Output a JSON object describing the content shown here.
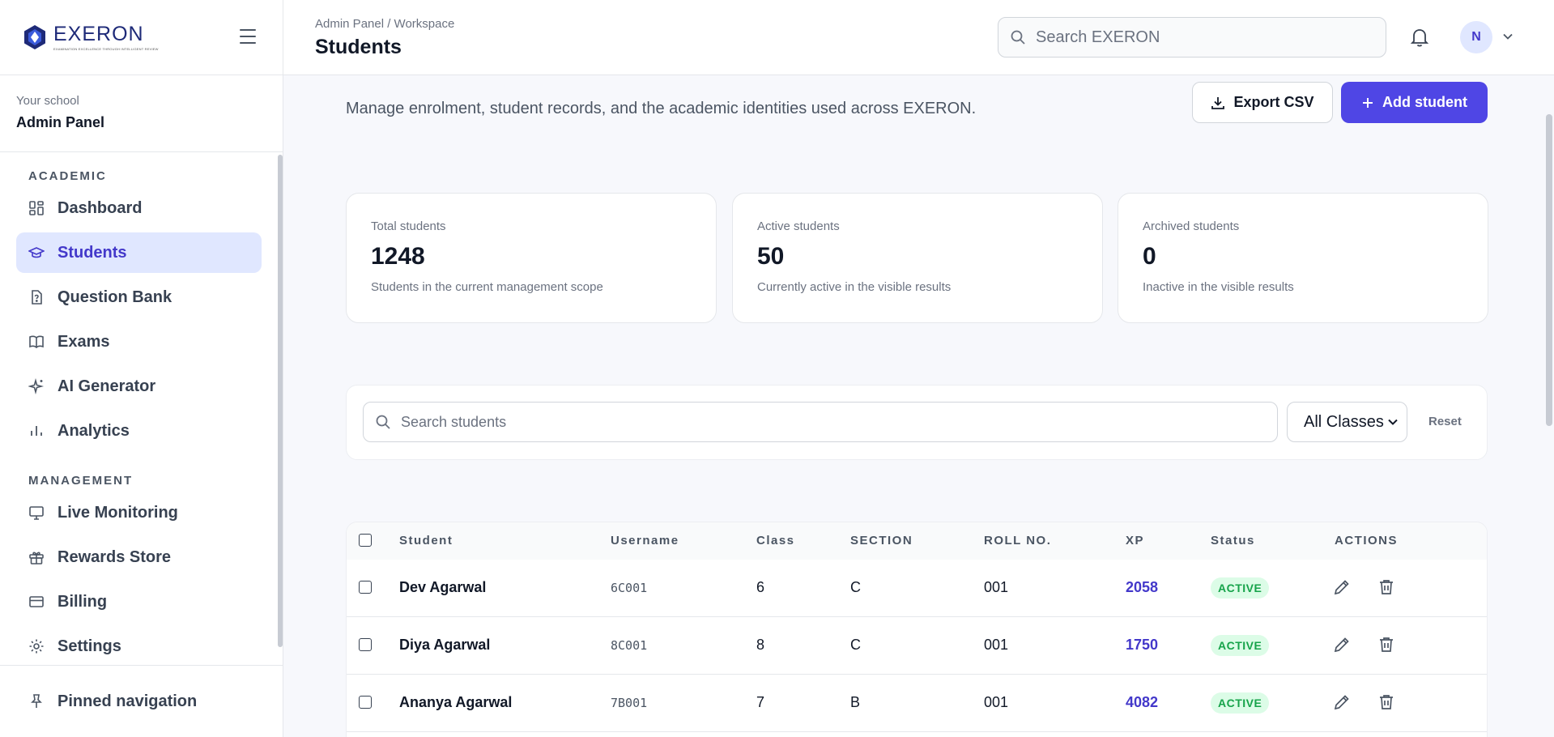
{
  "brand": {
    "name": "EXERON",
    "tagline": "EXAMINATION EXCELLENCE THROUGH INTELLIGENT REVIEW"
  },
  "school": {
    "label": "Your school",
    "name": "Admin Panel"
  },
  "nav": {
    "section_academic": "ACADEMIC",
    "section_management": "MANAGEMENT",
    "academic_items": [
      {
        "label": "Dashboard",
        "icon": "dashboard-grid-icon"
      },
      {
        "label": "Students",
        "icon": "graduation-cap-icon",
        "active": true
      },
      {
        "label": "Question Bank",
        "icon": "question-file-icon"
      },
      {
        "label": "Exams",
        "icon": "book-icon"
      },
      {
        "label": "AI Generator",
        "icon": "sparkles-icon"
      },
      {
        "label": "Analytics",
        "icon": "bar-chart-icon"
      }
    ],
    "management_items": [
      {
        "label": "Live Monitoring",
        "icon": "monitor-icon"
      },
      {
        "label": "Rewards Store",
        "icon": "gift-icon"
      },
      {
        "label": "Billing",
        "icon": "credit-card-icon"
      },
      {
        "label": "Settings",
        "icon": "gear-icon"
      }
    ],
    "pinned": "Pinned navigation"
  },
  "header": {
    "breadcrumb": "Admin Panel / Workspace",
    "title": "Students",
    "search_placeholder": "Search EXERON",
    "avatar_initial": "N"
  },
  "main": {
    "description": "Manage enrolment, student records, and the academic identities used across EXERON.",
    "export_label": "Export CSV",
    "add_label": "Add student"
  },
  "stats": [
    {
      "label": "Total students",
      "value": "1248",
      "desc": "Students in the current management scope"
    },
    {
      "label": "Active students",
      "value": "50",
      "desc": "Currently active in the visible results"
    },
    {
      "label": "Archived students",
      "value": "0",
      "desc": "Inactive in the visible results"
    }
  ],
  "filters": {
    "search_placeholder": "Search students",
    "class_selected": "All Classes",
    "reset_label": "Reset"
  },
  "table": {
    "headers": [
      "Student",
      "Username",
      "Class",
      "SECTION",
      "ROLL NO.",
      "XP",
      "Status",
      "ACTIONS"
    ],
    "rows": [
      {
        "name": "Dev Agarwal",
        "username": "6C001",
        "class": "6",
        "section": "C",
        "roll": "001",
        "xp": "2058",
        "status": "ACTIVE"
      },
      {
        "name": "Diya Agarwal",
        "username": "8C001",
        "class": "8",
        "section": "C",
        "roll": "001",
        "xp": "1750",
        "status": "ACTIVE"
      },
      {
        "name": "Ananya Agarwal",
        "username": "7B001",
        "class": "7",
        "section": "B",
        "roll": "001",
        "xp": "4082",
        "status": "ACTIVE"
      }
    ]
  },
  "colors": {
    "accent": "#4f46e5",
    "active_bg": "#e0e7ff",
    "status_green": "#16a34a"
  }
}
